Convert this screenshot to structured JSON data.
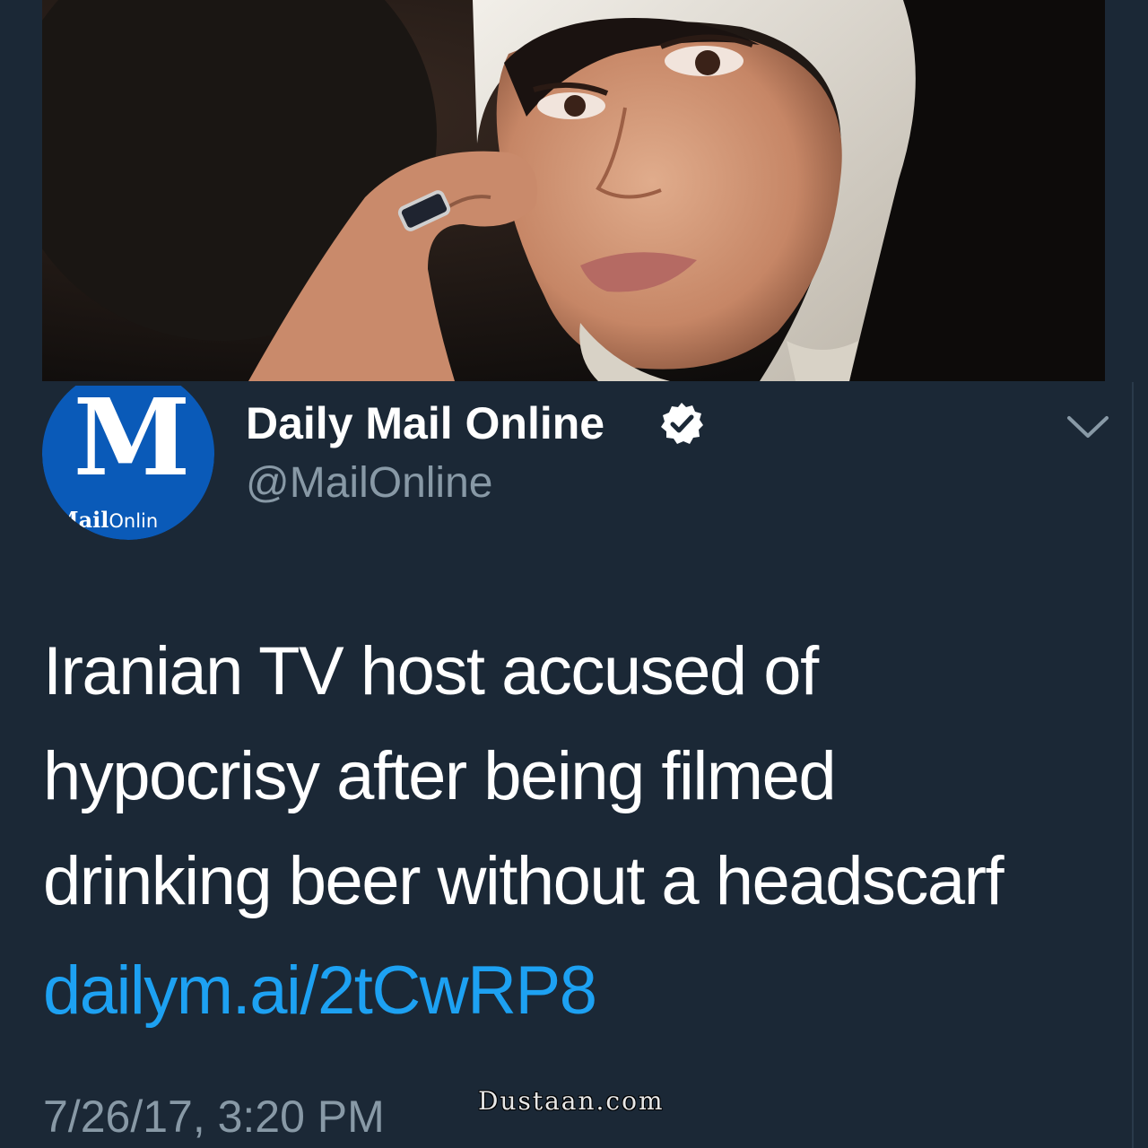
{
  "tweet": {
    "media": {
      "alt_icon": "photo"
    },
    "author": {
      "avatar_icon": "mailonline-logo",
      "avatar_letters": "M",
      "avatar_word_bold": "Mail",
      "avatar_word_light": "Onlin",
      "display_name": "Daily Mail Online",
      "verified": true,
      "handle": "@MailOnline"
    },
    "menu_icon": "chevron-down-icon",
    "text_lines": [
      "Iranian TV host accused of",
      "hypocrisy after being filmed",
      "drinking beer without a headscarf"
    ],
    "link": "dailym.ai/2tCwRP8",
    "timestamp": "7/26/17, 3:20 PM"
  },
  "watermark": "Dustaan.com",
  "colors": {
    "background": "#1b2836",
    "link": "#1da1f2",
    "secondary_text": "#8899a6",
    "avatar_blue": "#0a5ab8"
  }
}
